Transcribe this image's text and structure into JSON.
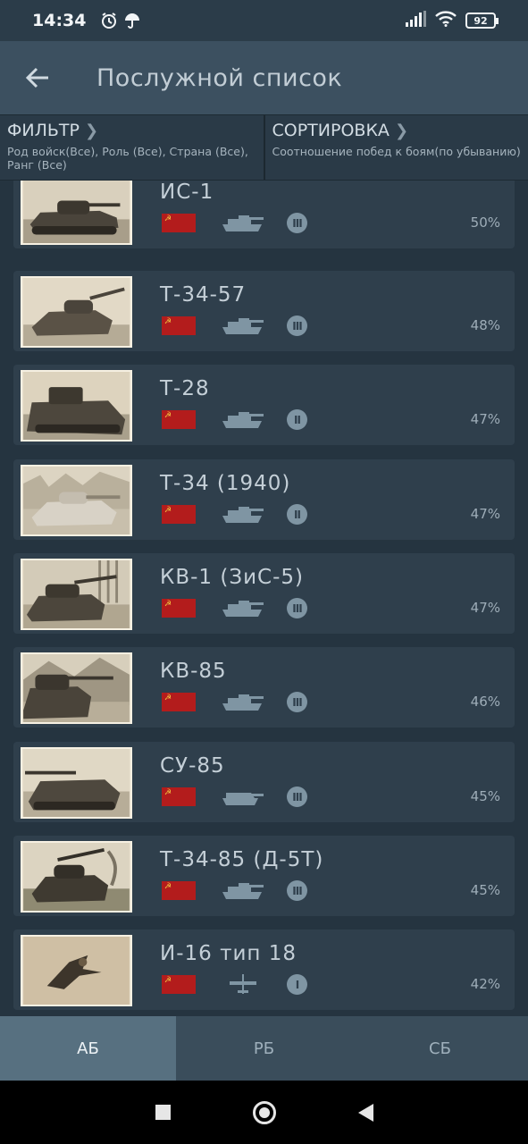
{
  "status": {
    "time": "14:34",
    "battery": "92",
    "icons": [
      "alarm-icon",
      "umbrella-icon",
      "signal-icon",
      "wifi-icon",
      "battery-icon"
    ]
  },
  "header": {
    "title": "Послужной список",
    "back_icon": "arrow-left-icon"
  },
  "filter": {
    "label": "ФИЛЬТР",
    "value": "Род войск(Все), Роль (Все), Страна (Все), Ранг (Все)"
  },
  "sort": {
    "label": "СОРТИРОВКА",
    "value": "Соотношение побед к боям(по убыванию)"
  },
  "vehicles": [
    {
      "name": "ИС-1",
      "type": "tank-icon",
      "rank": "III",
      "win_rate": "50%"
    },
    {
      "name": "Т-34-57",
      "type": "tank-icon",
      "rank": "III",
      "win_rate": "48%"
    },
    {
      "name": "Т-28",
      "type": "tank-icon",
      "rank": "II",
      "win_rate": "47%"
    },
    {
      "name": "Т-34 (1940)",
      "type": "tank-icon",
      "rank": "II",
      "win_rate": "47%"
    },
    {
      "name": "КВ-1 (ЗиС-5)",
      "type": "tank-icon",
      "rank": "III",
      "win_rate": "47%"
    },
    {
      "name": "КВ-85",
      "type": "tank-icon",
      "rank": "III",
      "win_rate": "46%"
    },
    {
      "name": "СУ-85",
      "type": "tank-destroyer-icon",
      "rank": "III",
      "win_rate": "45%"
    },
    {
      "name": "Т-34-85 (Д-5Т)",
      "type": "tank-icon",
      "rank": "III",
      "win_rate": "45%"
    },
    {
      "name": "И-16 тип 18",
      "type": "plane-icon",
      "rank": "I",
      "win_rate": "42%"
    }
  ],
  "tabs": [
    {
      "label": "АБ",
      "active": true
    },
    {
      "label": "РБ",
      "active": false
    },
    {
      "label": "СБ",
      "active": false
    }
  ],
  "colors": {
    "accent_tab": "#577080",
    "flag_red": "#b31c1c",
    "card_bg": "#2f3f4c"
  }
}
